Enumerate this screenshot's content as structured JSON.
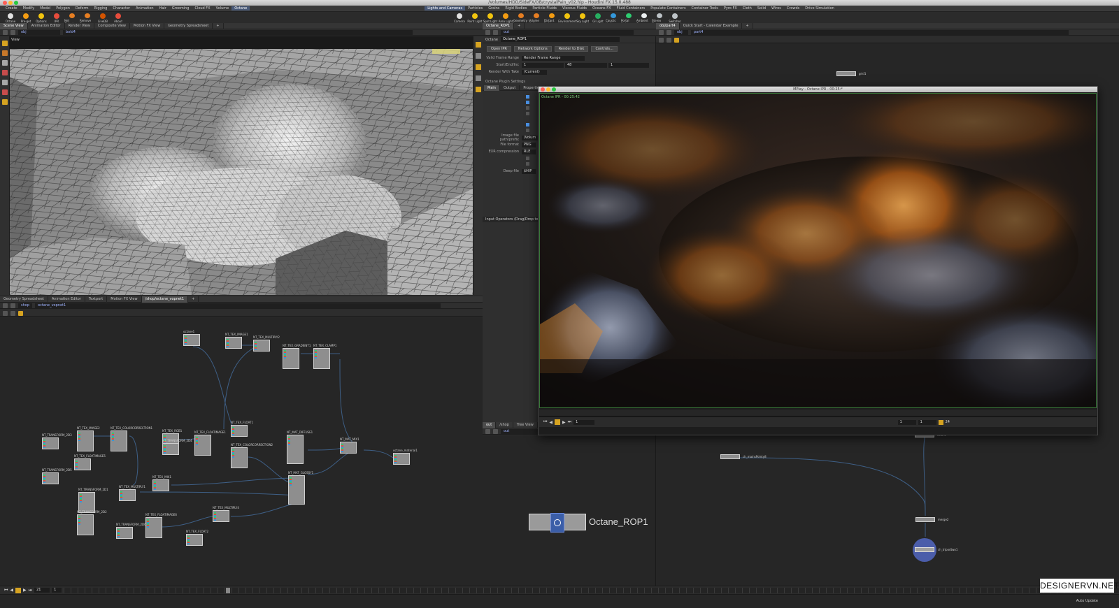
{
  "window": {
    "title": "/Volumes/HDD/SideFX/OB/crystalPain_v02.hip - Houdini FX 15.0.488"
  },
  "menu": [
    "Create",
    "Modify",
    "Model",
    "Polygon",
    "Deform",
    "Rigging",
    "Character",
    "Animation",
    "Hair",
    "Grooming",
    "Cloud FX",
    "Volume",
    "Octane"
  ],
  "right_shelf_tabs": [
    "Lights and Cameras",
    "Particles",
    "Grains",
    "Rigid Bodies",
    "Particle Fluids",
    "Viscous Fluids",
    "Oceans FX",
    "Fluid Containers",
    "Populate Containers",
    "Container Tools",
    "Pyro FX",
    "Cloth",
    "Solid",
    "Wires",
    "Crowds",
    "Drive Simulation"
  ],
  "left_tools": [
    {
      "label": "Octane",
      "color": "#e0e0e0"
    },
    {
      "label": "Pre-get",
      "color": "#f39c12"
    },
    {
      "label": "Options",
      "color": "#f1c40f"
    },
    {
      "label": "IPR",
      "color": "#e74c3c"
    },
    {
      "label": "Net Objects",
      "color": "#e67e22"
    },
    {
      "label": "Remove Oc.",
      "color": "#e67e22"
    },
    {
      "label": "LiveDB",
      "color": "#d35400"
    },
    {
      "label": "About",
      "color": "#e74c3c"
    }
  ],
  "right_tools": [
    {
      "label": "Camera",
      "color": "#e0e0e0"
    },
    {
      "label": "Point Light",
      "color": "#f1c40f"
    },
    {
      "label": "Spot Light",
      "color": "#f1c40f"
    },
    {
      "label": "Area Light",
      "color": "#f39c12"
    },
    {
      "label": "Geometry L.",
      "color": "#e67e22"
    },
    {
      "label": "Volume Light",
      "color": "#e67e22"
    },
    {
      "label": "Distant Light",
      "color": "#f39c12"
    },
    {
      "label": "Environment",
      "color": "#f1c40f"
    },
    {
      "label": "Sky Light",
      "color": "#f1c40f"
    },
    {
      "label": "GI Light",
      "color": "#27ae60"
    },
    {
      "label": "Caustic Light",
      "color": "#3498db"
    },
    {
      "label": "Portal Light",
      "color": "#2ecc71"
    },
    {
      "label": "Ambient Occ.",
      "color": "#ecf0f1"
    },
    {
      "label": "Stereo Cam",
      "color": "#bdc3c7"
    },
    {
      "label": "Switcher",
      "color": "#bdc3c7"
    }
  ],
  "left_pane": {
    "tabs": [
      "Scene View",
      "Animation Editor",
      "Render View",
      "Composite View",
      "Motion FX View",
      "Geometry Spreadsheet"
    ],
    "path": "obj",
    "node": "bold4",
    "view_label": "View"
  },
  "mid_pane": {
    "tabs": [
      "Octane_ROP1"
    ],
    "path": "out",
    "node_name": "Octane_ROP1",
    "node_type": "Octane",
    "buttons": [
      "Open IPR",
      "Network Options",
      "Render to Disk",
      "Controls..."
    ],
    "valid_frame_range_label": "Valid Frame Range",
    "valid_frame_range": "Render Frame Range",
    "start_end_label": "Start/End/Inc",
    "start": "1",
    "end": "48",
    "inc": "1",
    "render_with_take_label": "Render With Take",
    "render_with_take": "(Current)",
    "plugin_settings": "Octane Plugin Settings",
    "settings_tabs": [
      "Main",
      "Output",
      "Properties"
    ],
    "image_file_label": "Image file path/prefix",
    "image_file": "/Volum",
    "file_format_label": "File format",
    "file_format": "PNG",
    "exr_label": "EXR compression",
    "exr": "RLE",
    "deep_file_label": "Deep file",
    "deep_file": "$HIP",
    "input_operators": "Input Operators (Drag/Drop to"
  },
  "right_pane": {
    "tabs": [
      "obj/part4",
      "Quick Start - Calendar Example"
    ],
    "path": "obj",
    "node": "part4",
    "nodes": [
      {
        "name": "grid1"
      },
      {
        "name": "ch_mainsPointy8"
      },
      {
        "name": "merge2"
      },
      {
        "name": "ch_tripodtwo1"
      },
      {
        "name": "color1"
      }
    ]
  },
  "bottom_left_pane": {
    "tabs": [
      "Geometry Spreadsheet",
      "Animation Editor",
      "Textport",
      "Motion FX View",
      "/shop/octane_vopnet1"
    ],
    "path": "shop",
    "node": "octane_vopnet1",
    "nodes": [
      {
        "name": "octane1"
      },
      {
        "name": "NT_TEX_IMAGE1"
      },
      {
        "name": "NT_TEX_MULTIPLY2"
      },
      {
        "name": "NT_TEX_GRADIENT1"
      },
      {
        "name": "NT_TEX_CLAMP1"
      },
      {
        "name": "NT_TEX_IMAGE2"
      },
      {
        "name": "NT_TEX_COLORCORRECTION1"
      },
      {
        "name": "NT_TRANSFORM_2D3"
      },
      {
        "name": "NT_TEX_RGB1"
      },
      {
        "name": "NT_TEX_FLOATIMAGE1"
      },
      {
        "name": "NT_TEX_FLOAT1"
      },
      {
        "name": "NT_MAT_MIX1"
      },
      {
        "name": "NT_TRANSFORM_2D4"
      },
      {
        "name": "NT_TEX_COLORCORRECTION2"
      },
      {
        "name": "NT_TEX_FLOATIMAGE5"
      },
      {
        "name": "NT_TRANSFORM_2D5"
      },
      {
        "name": "NT_TEX_MULTIPLY1"
      },
      {
        "name": "NT_TEX_MIX1"
      },
      {
        "name": "NT_MAT_GLOSSY1"
      },
      {
        "name": "NT_TEX_FLOATIMAGE6"
      },
      {
        "name": "NT_TRANSFORM_2D6"
      },
      {
        "name": "NT_TEX_MULTIPLY4"
      },
      {
        "name": "NT_TEX_FLOAT2"
      },
      {
        "name": "octane_material1"
      },
      {
        "name": "NT_MAT_DIFFUSE1"
      },
      {
        "name": "NT_TRANSFORM_2D1"
      },
      {
        "name": "NT_TRANSFORM_2D2"
      }
    ]
  },
  "bottom_mid_pane": {
    "tabs": [
      "out",
      "/shop",
      "Tree View"
    ],
    "path": "out",
    "rop_label": "Octane_ROP1"
  },
  "mplay": {
    "title": "MPlay - Octane IPR - 00:25:*",
    "overlay": "Octane IPR - 00:25:42",
    "frame": "1",
    "frame_start": "1",
    "frame_end": "1",
    "fps": "24"
  },
  "timeline": {
    "current_frame": "21",
    "start": "1",
    "auto_update": "Auto Update"
  },
  "watermark": "DESIGNERVN.NET"
}
